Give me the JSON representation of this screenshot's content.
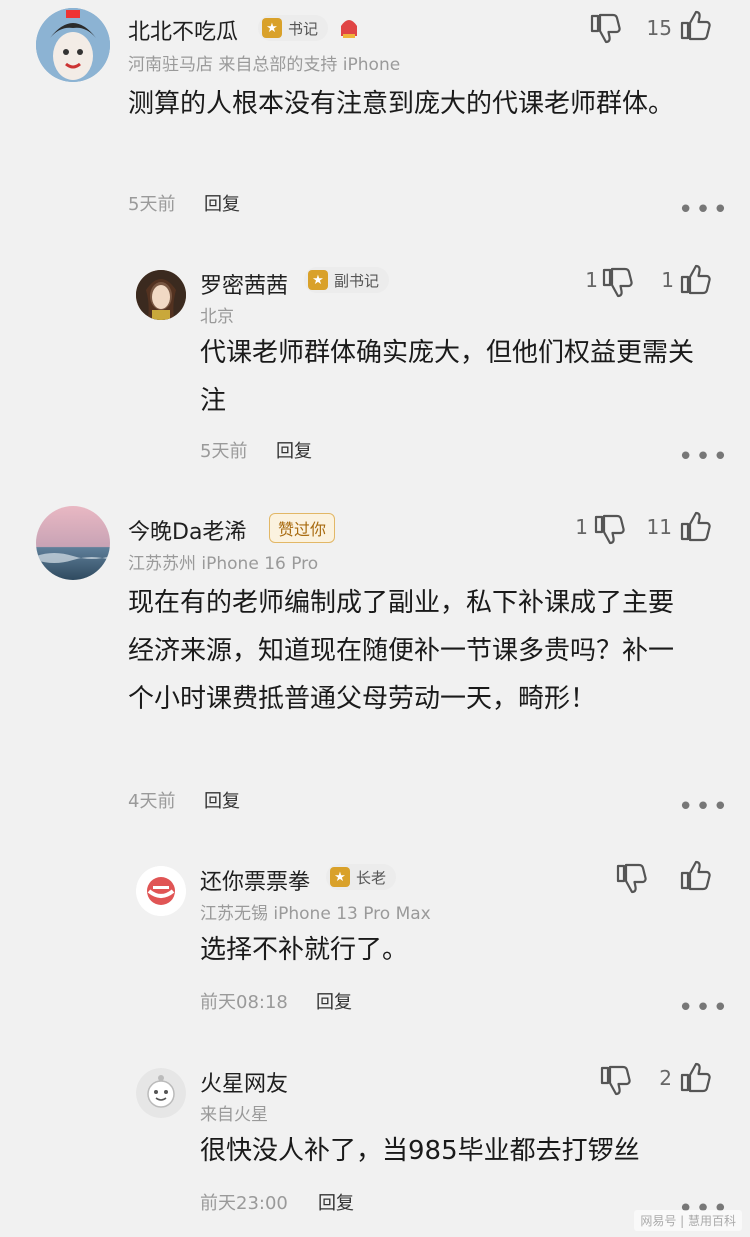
{
  "comments": [
    {
      "name": "北北不吃瓜",
      "badge": "书记",
      "meta": "河南驻马店  来自总部的支持  iPhone",
      "text": "测算的人根本没有注意到庞大的代课老师群体。",
      "time": "5天前",
      "reply_label": "回复",
      "dislike_count": "",
      "like_count": "15"
    },
    {
      "name": "罗密茜茜",
      "badge": "副书记",
      "meta": "北京",
      "text": "代课老师群体确实庞大，但他们权益更需关注",
      "time": "5天前",
      "reply_label": "回复",
      "dislike_count": "1",
      "like_count": "1"
    },
    {
      "name": "今晚Da老浠",
      "praise_badge": "赞过你",
      "meta": "江苏苏州  iPhone 16 Pro",
      "text": "现在有的老师编制成了副业，私下补课成了主要经济来源，知道现在随便补一节课多贵吗？补一个小时课费抵普通父母劳动一天，畸形！",
      "time": "4天前",
      "reply_label": "回复",
      "dislike_count": "1",
      "like_count": "11"
    },
    {
      "name": "还你票票拳",
      "badge": "长老",
      "meta": "江苏无锡  iPhone 13 Pro Max",
      "text": "选择不补就行了。",
      "time": "前天08:18",
      "reply_label": "回复",
      "dislike_count": "",
      "like_count": ""
    },
    {
      "name": "火星网友",
      "meta": "来自火星",
      "text": "很快没人补了，当985毕业都去打锣丝",
      "time": "前天23:00",
      "reply_label": "回复",
      "dislike_count": "",
      "like_count": "2"
    }
  ],
  "more_label": "•••",
  "watermark": "网易号 | 慧用百科",
  "icons": {
    "like": "thumbs-up-icon",
    "dislike": "thumbs-down-icon",
    "more": "more-dots-icon"
  }
}
